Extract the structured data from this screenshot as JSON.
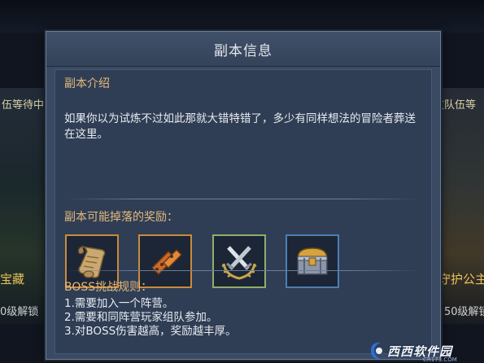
{
  "background": {
    "left_team_tag": "伍等待中",
    "right_team_tag": "友队伍等",
    "left_card_name": "宝藏",
    "right_card_name": "守护公主",
    "left_unlock": "0级解锁",
    "right_unlock": "50级解锁"
  },
  "dialog": {
    "title": "副本信息",
    "intro_label": "副本介绍",
    "intro_text": "如果你以为试炼不过如此那就大错特错了，多少有同样想法的冒险者葬送在这里。",
    "rewards_label": "副本可能掉落的奖励：",
    "rewards": [
      {
        "icon": "scroll-icon"
      },
      {
        "icon": "hinge-icon"
      },
      {
        "icon": "crossed-swords-laurel-icon"
      },
      {
        "icon": "treasure-chest-icon"
      }
    ],
    "rules_label": "BOSS挑战规则：",
    "rules": [
      "1.需要加入一个阵营。",
      "2.需要和同阵营玩家组队参加。",
      "3.对BOSS伤害越高，奖励越丰厚。"
    ]
  },
  "watermark": {
    "text": "西西软件园",
    "url": "CR173.COM"
  }
}
